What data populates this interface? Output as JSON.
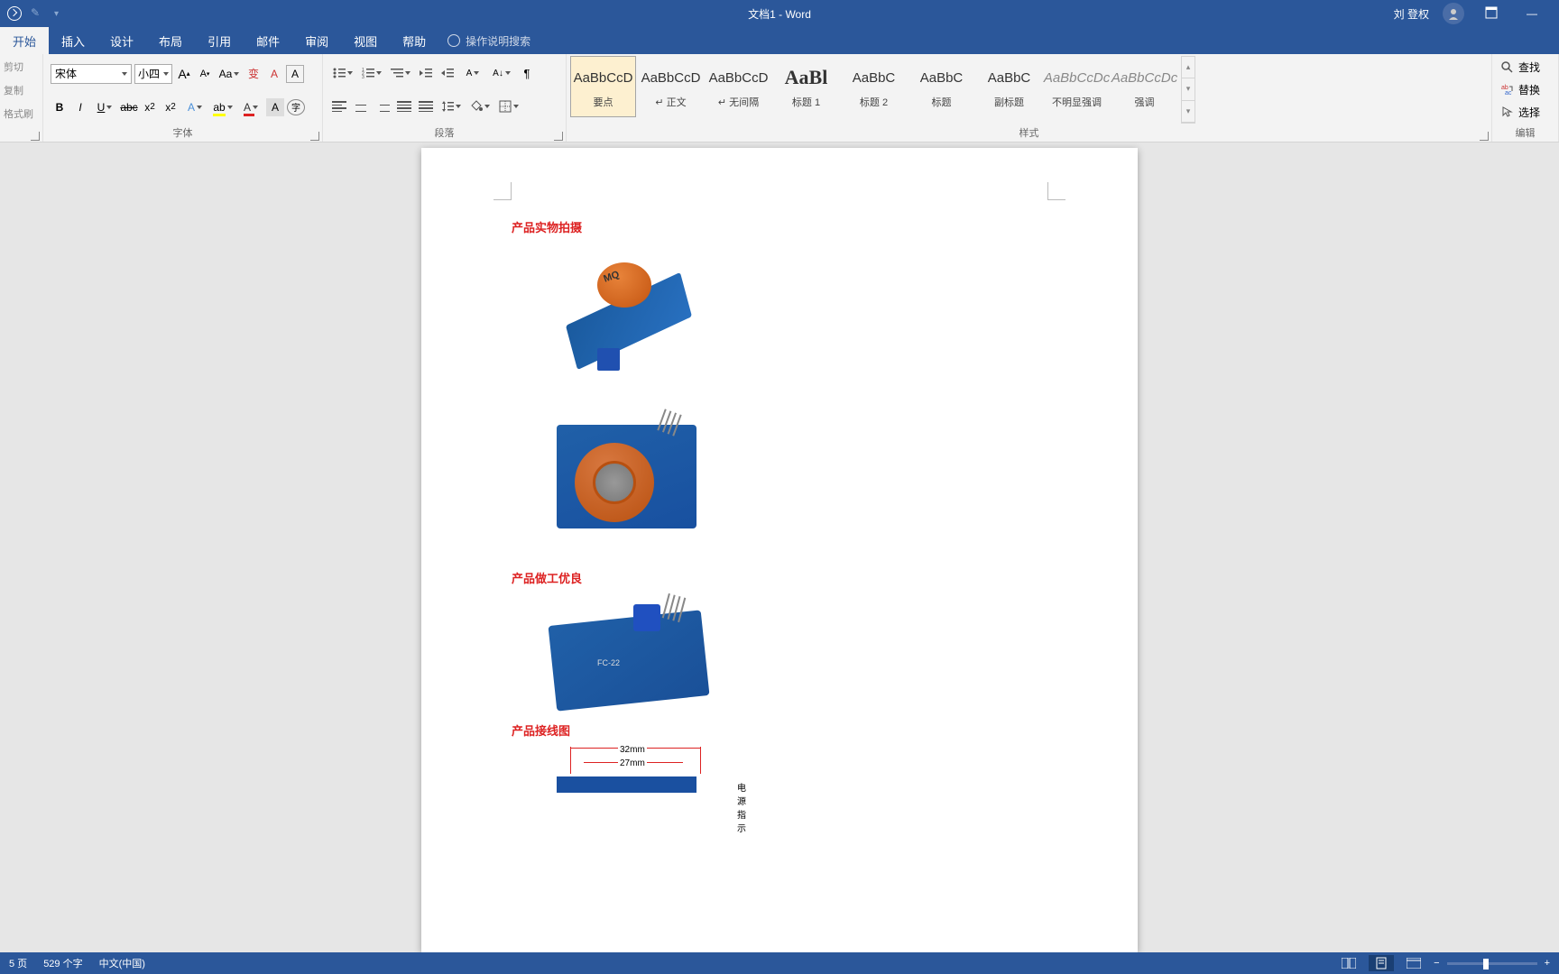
{
  "titlebar": {
    "doc_title": "文档1 - Word",
    "user_name": "刘 登权"
  },
  "tabs": {
    "items": [
      "开始",
      "插入",
      "设计",
      "布局",
      "引用",
      "邮件",
      "审阅",
      "视图",
      "帮助"
    ],
    "active_index": 0,
    "tell_me": "操作说明搜索"
  },
  "clipboard": {
    "cut": "剪切",
    "copy": "复制",
    "paint": "格式刷"
  },
  "font": {
    "name": "宋体",
    "size": "小四",
    "group_label": "字体"
  },
  "paragraph": {
    "group_label": "段落"
  },
  "styles": {
    "group_label": "样式",
    "items": [
      {
        "preview": "AaBbCcD",
        "label": "要点",
        "cls": "",
        "active": true
      },
      {
        "preview": "AaBbCcD",
        "label": "↵ 正文",
        "cls": ""
      },
      {
        "preview": "AaBbCcD",
        "label": "↵ 无间隔",
        "cls": ""
      },
      {
        "preview": "AaBl",
        "label": "标题 1",
        "cls": "heading"
      },
      {
        "preview": "AaBbC",
        "label": "标题 2",
        "cls": ""
      },
      {
        "preview": "AaBbC",
        "label": "标题",
        "cls": ""
      },
      {
        "preview": "AaBbC",
        "label": "副标题",
        "cls": ""
      },
      {
        "preview": "AaBbCcDc",
        "label": "不明显强调",
        "cls": "subtle"
      },
      {
        "preview": "AaBbCcDc",
        "label": "强调",
        "cls": "subtle"
      }
    ]
  },
  "editing": {
    "find": "查找",
    "replace": "替换",
    "select": "选择",
    "group_label": "编辑"
  },
  "document": {
    "label1": "产品实物拍摄",
    "label2": "产品做工优良",
    "label3": "产品接线图",
    "dim1": "32mm",
    "dim2": "27mm",
    "fc": "FC-22",
    "mq": "MQ",
    "power_indicator": "电源指示"
  },
  "statusbar": {
    "page": "5 页",
    "words": "529 个字",
    "lang": "中文(中国)"
  }
}
